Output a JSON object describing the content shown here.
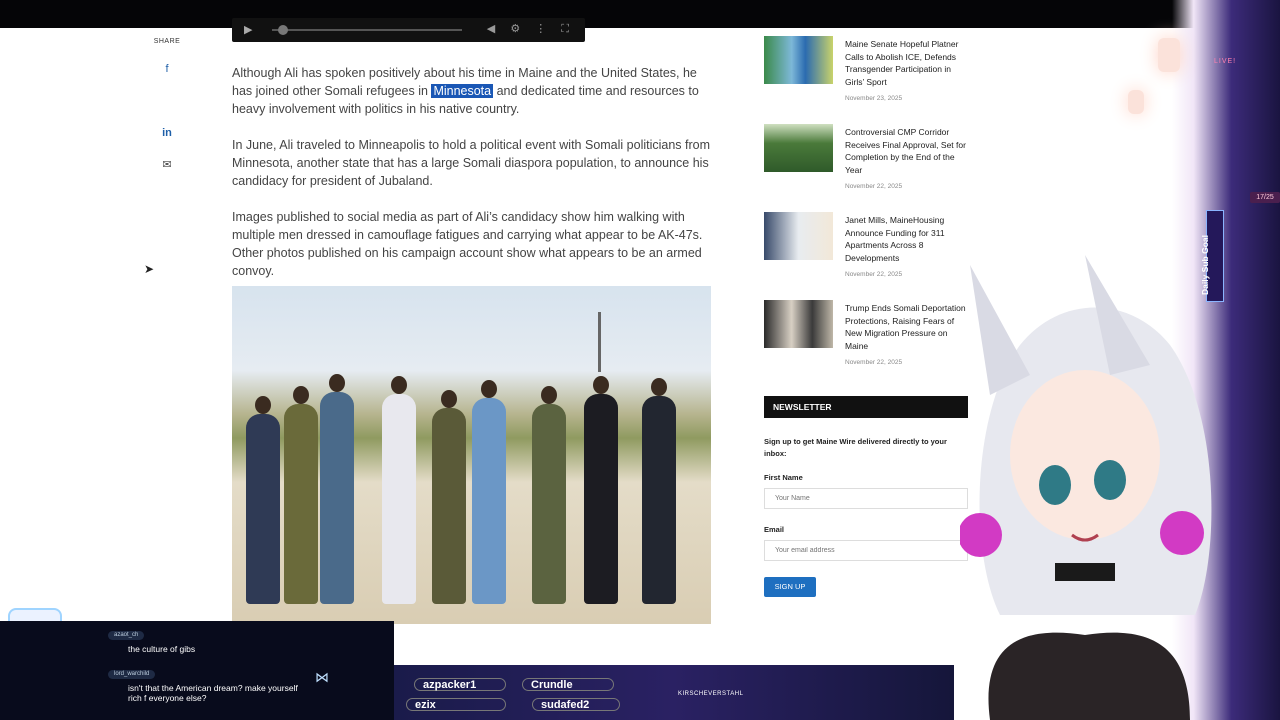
{
  "share": {
    "label": "SHARE",
    "buttons": [
      {
        "icon": "facebook-icon",
        "glyph": "f"
      },
      {
        "icon": "twitter-icon",
        "glyph": ""
      },
      {
        "icon": "linkedin-icon",
        "glyph": "in"
      },
      {
        "icon": "email-icon",
        "glyph": "✉"
      }
    ]
  },
  "article": {
    "p1_before": "Although Ali has spoken positively about his time in Maine and the United States, he has joined other Somali refugees in ",
    "p1_link": "Minnesota",
    "p1_after": " and dedicated time and resources to heavy involvement with politics in his native country.",
    "p2": "In June, Ali traveled to Minneapolis to hold a political event with Somali politicians from Minnesota, another state that has a large Somali diaspora population, to announce his candidacy for president of Jubaland.",
    "p3": "Images published to social media as part of Ali’s candidacy show him walking with multiple men dressed in camouflage fatigues and carrying what appear to be AK-47s. Other photos published on his campaign account show what appears to be an armed convoy."
  },
  "sidebar": {
    "items": [
      {
        "title": "Maine Senate Hopeful Platner Calls to Abolish ICE, Defends Transgender Participation in Girls’ Sport",
        "date": "November 23, 2025"
      },
      {
        "title": "Controversial CMP Corridor Receives Final Approval, Set for Completion by the End of the Year",
        "date": "November 22, 2025"
      },
      {
        "title": "Janet Mills, MaineHousing Announce Funding for 311 Apartments Across 8 Developments",
        "date": "November 22, 2025"
      },
      {
        "title": "Trump Ends Somali Deportation Protections, Raising Fears of New Migration Pressure on Maine",
        "date": "November 22, 2025"
      }
    ]
  },
  "newsletter": {
    "heading": "NEWSLETTER",
    "text": "Sign up to get Maine Wire delivered directly to your inbox:",
    "first_name_label": "First Name",
    "first_name_placeholder": "Your Name",
    "email_label": "Email",
    "email_placeholder": "Your email address",
    "button": "SIGN UP"
  },
  "overlay": {
    "live": "LIVE!",
    "sub_goal": "Daily Sub Goal",
    "goal_count": "17/25",
    "chat": [
      {
        "user": "azaot_ch",
        "message": "the culture of gibs"
      },
      {
        "user": "lord_warchild",
        "message": "isn't that the American dream? make yourself rich f everyone else?"
      }
    ],
    "ticker": [
      "azpacker1",
      "Crundle",
      "ezix",
      "sudafed2"
    ],
    "footer_name": "KIRSCHEVERSTAHL"
  }
}
